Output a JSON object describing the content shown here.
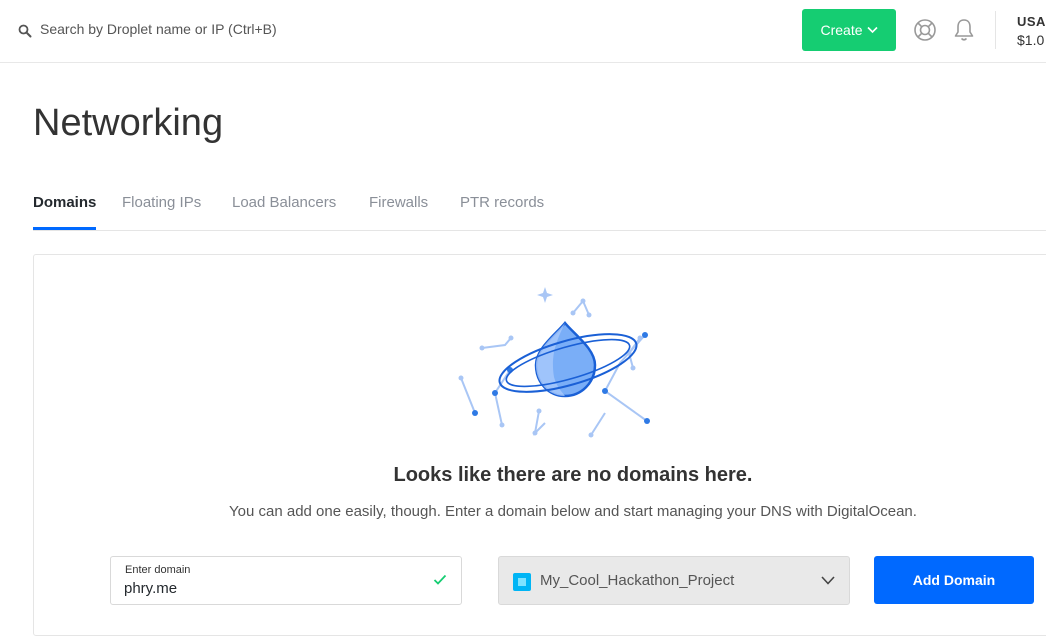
{
  "header": {
    "search": {
      "placeholder": "Search by Droplet name or IP (Ctrl+B)",
      "value": ""
    },
    "create_label": "Create",
    "account": {
      "name": "USA",
      "balance": "$1.0"
    }
  },
  "page": {
    "title": "Networking"
  },
  "tabs": [
    {
      "label": "Domains",
      "active": true
    },
    {
      "label": "Floating IPs",
      "active": false
    },
    {
      "label": "Load Balancers",
      "active": false
    },
    {
      "label": "Firewalls",
      "active": false
    },
    {
      "label": "PTR records",
      "active": false
    }
  ],
  "empty_state": {
    "heading": "Looks like there are no domains here.",
    "description": "You can add one easily, though. Enter a domain below and start managing your DNS with DigitalOcean."
  },
  "form": {
    "domain_label": "Enter domain",
    "domain_value": "phry.me",
    "project_value": "My_Cool_Hackathon_Project",
    "submit_label": "Add Domain"
  },
  "colors": {
    "create_button": "#15cd72",
    "primary_button": "#0069ff",
    "active_tab_underline": "#0069ff",
    "valid_check": "#15cd72",
    "project_icon": "#00b5f5"
  },
  "icons": [
    "search-icon",
    "chevron-down-icon",
    "help-icon",
    "bell-icon",
    "check-icon",
    "droplet-planet-illustration"
  ]
}
